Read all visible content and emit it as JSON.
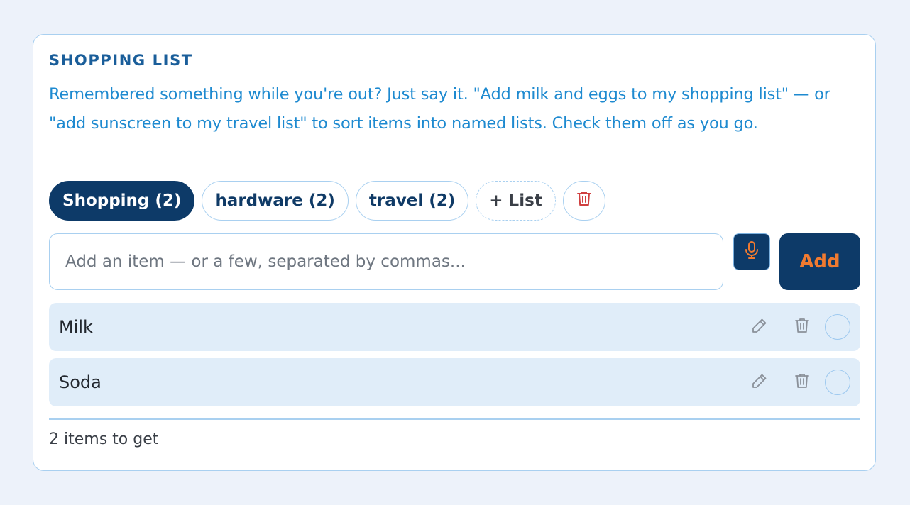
{
  "card": {
    "title": "SHOPPING LIST",
    "description": "Remembered something while you're out? Just say it. \"Add milk and eggs to my shopping list\" — or \"add sunscreen to my travel list\" to sort items into named lists. Check them off as you go."
  },
  "tabs": [
    {
      "label": "Shopping (2)",
      "active": true
    },
    {
      "label": "hardware (2)",
      "active": false
    },
    {
      "label": "travel (2)",
      "active": false
    }
  ],
  "add_list_label": "+ List",
  "input": {
    "placeholder": "Add an item — or a few, separated by commas...",
    "value": ""
  },
  "add_button_label": "Add",
  "items": [
    {
      "label": "Milk",
      "checked": false
    },
    {
      "label": "Soda",
      "checked": false
    }
  ],
  "footer": {
    "summary": "2 items to get"
  },
  "icons": {
    "delete_list": "trash-icon",
    "mic": "microphone-icon",
    "edit": "pencil-icon",
    "delete_item": "trash-icon",
    "check": "circle-checkbox"
  },
  "colors": {
    "accent_dark": "#0d3a68",
    "accent_orange": "#f07a30",
    "description_blue": "#1e8ad0",
    "danger_red": "#d04040",
    "item_background": "#e0edf9",
    "border": "#a9d0f0"
  }
}
